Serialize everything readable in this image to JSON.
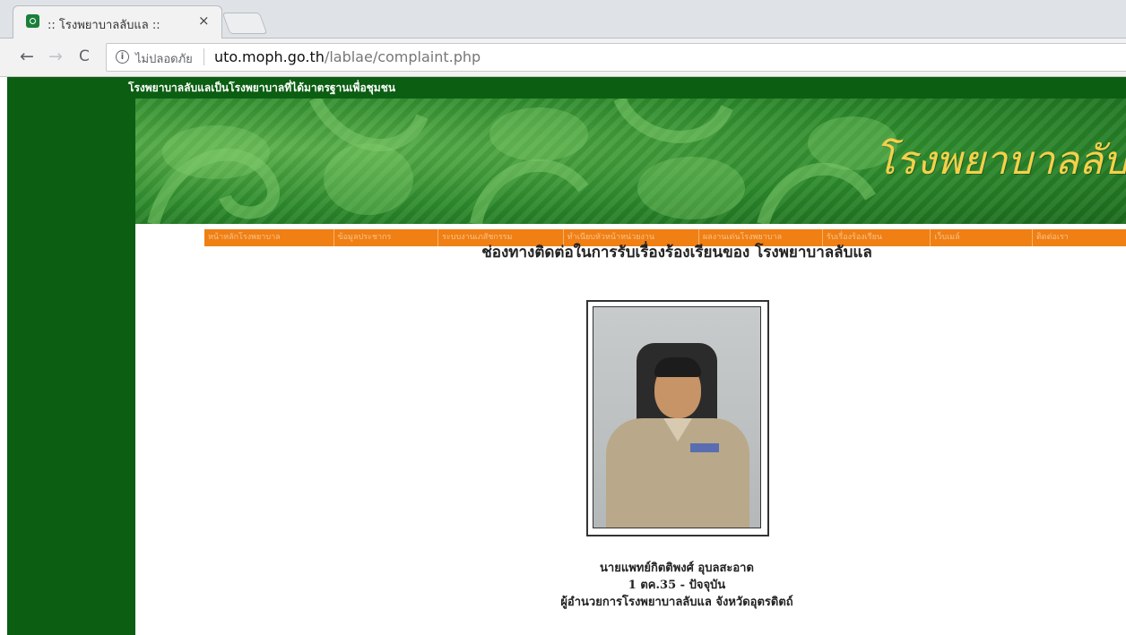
{
  "browser": {
    "tab_title": ":: โรงพยาบาลลับแล ::",
    "tab_close": "×",
    "back": "←",
    "forward": "→",
    "reload": "C",
    "info": "i",
    "security_label": "ไม่ปลอดภัย",
    "url_host": "uto.moph.go.th",
    "url_path": "/lablae/complaint.php"
  },
  "header": {
    "slogan": "โรงพยาบาลลับแลเป็นโรงพยาบาลที่ได้มาตรฐานเพื่อชุมชน",
    "banner_title": "โรงพยาบาลลับ"
  },
  "menu": {
    "items": [
      {
        "label": "หน้าหลักโรงพยาบาล",
        "width": 145
      },
      {
        "label": "ข้อมูลประชากร",
        "width": 116
      },
      {
        "label": "ระบบงานเภสัชกรรม",
        "width": 140
      },
      {
        "label": "ทำเนียบหัวหน้าหน่วยงาน",
        "width": 152
      },
      {
        "label": "ผลงานเด่นโรงพยาบาล",
        "width": 138
      },
      {
        "label": "รับเรื่องร้องเรียน",
        "width": 120
      },
      {
        "label": "เว็บเมล์",
        "width": 113
      },
      {
        "label": "ติดต่อเรา",
        "width": 104
      }
    ]
  },
  "main": {
    "heading": "ช่องทางติดต่อในการรับเรื่องร้องเรียนของ โรงพยาบาลลับแล",
    "person_name": "นายแพทย์กิตติพงศ์ อุบลสะอาด",
    "tenure": "1 ตค.35 - ปัจจุบัน",
    "position": "ผู้อำนวยการโรงพยาบาลลับแล จังหวัดอุตรดิตถ์"
  }
}
